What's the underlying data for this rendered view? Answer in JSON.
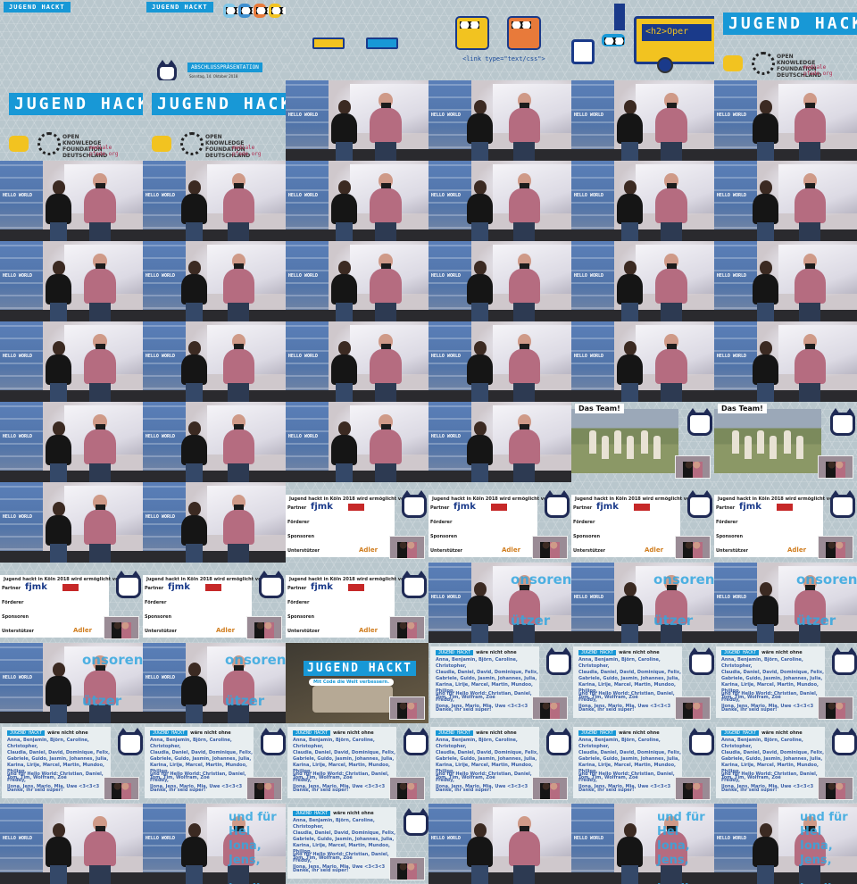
{
  "title_slide": {
    "banner": "JUGEND HACKT",
    "sponsor_name": "OPEN KNOWLEDGE FOUNDATION DEUTSCHLAND",
    "partner_name": "mediale pfade.org"
  },
  "intro_slide": {
    "banner_small": "JUGEND HACKT",
    "banner_sub": "2018",
    "subtitle": "ABSCHLUSSPRÄSENTATION",
    "date_line": "Sonntag, 14. Oktober 2018"
  },
  "code_slide": {
    "code_text": "<link type=\"text/css\">",
    "bus_text": "<h2>Oper"
  },
  "team_slide": {
    "caption": "Das Team!"
  },
  "sponsor_slide": {
    "title": "Jugend hackt in Köln 2018 wird ermöglicht von:",
    "row_partner": "Partner",
    "row_foerderer": "Förderer",
    "row_sponsoren": "Sponsoren",
    "row_unterstuetzer": "Unterstützer",
    "fjmk": "fjmk",
    "adler": "Adler"
  },
  "overlay_sponsoren": {
    "word1": "onsoren",
    "word2": "ützer"
  },
  "motto_slide": {
    "banner": "JUGEND HACKT",
    "motto": "Mit Code die Welt verbessern."
  },
  "thanks_slide": {
    "badge": "JUGEND HACKT",
    "header": "wäre nicht ohne",
    "names": "Anna, Benjamin, Björn, Caroline, Christopher,\nClaudia, Daniel, David, Dominique, Felix,\nGabriele, Guido, Jasmin, Johannes, Julia,\nKarina, Lirije, Marcel, Martin, Mundoo, Philipp,\nTom, Tim, Wolfram, Zoé",
    "helfer": "und für Hello World: Christian, Daniel, Freddy,\nIlona, Jens, Mario, Mia, Uwe <3<3<3",
    "danke": "Danke, ihr seid super!"
  },
  "overlay_helfer": {
    "text": "und für Hel\nIona, Jens,\n\nke, ihr se"
  },
  "wall_sign": "HELLO WORLD"
}
